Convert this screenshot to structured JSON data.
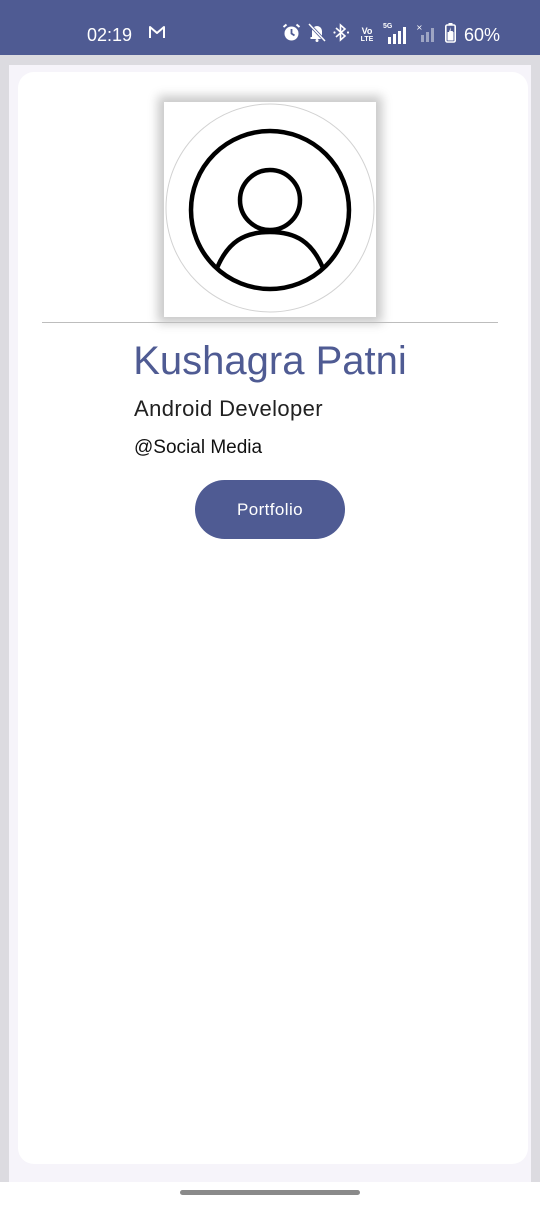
{
  "status_bar": {
    "time": "02:19",
    "network_label": "5G",
    "volte_top": "Vo",
    "volte_bottom": "LTE",
    "battery_percent": "60%",
    "icons": [
      "gmail-icon",
      "alarm-icon",
      "mute-icon",
      "bluetooth-icon",
      "volte-icon",
      "signal-icon",
      "signal-icon-2",
      "battery-icon"
    ],
    "background_color": "#4f5b93"
  },
  "profile": {
    "avatar_icon": "account-circle-icon",
    "name": "Kushagra Patni",
    "role": "Android Developer",
    "social": "@Social Media",
    "portfolio_button": "Portfolio"
  },
  "theme": {
    "accent": "#4f5b93",
    "card_background": "#ffffff",
    "screen_background": "#dcdbe0"
  }
}
